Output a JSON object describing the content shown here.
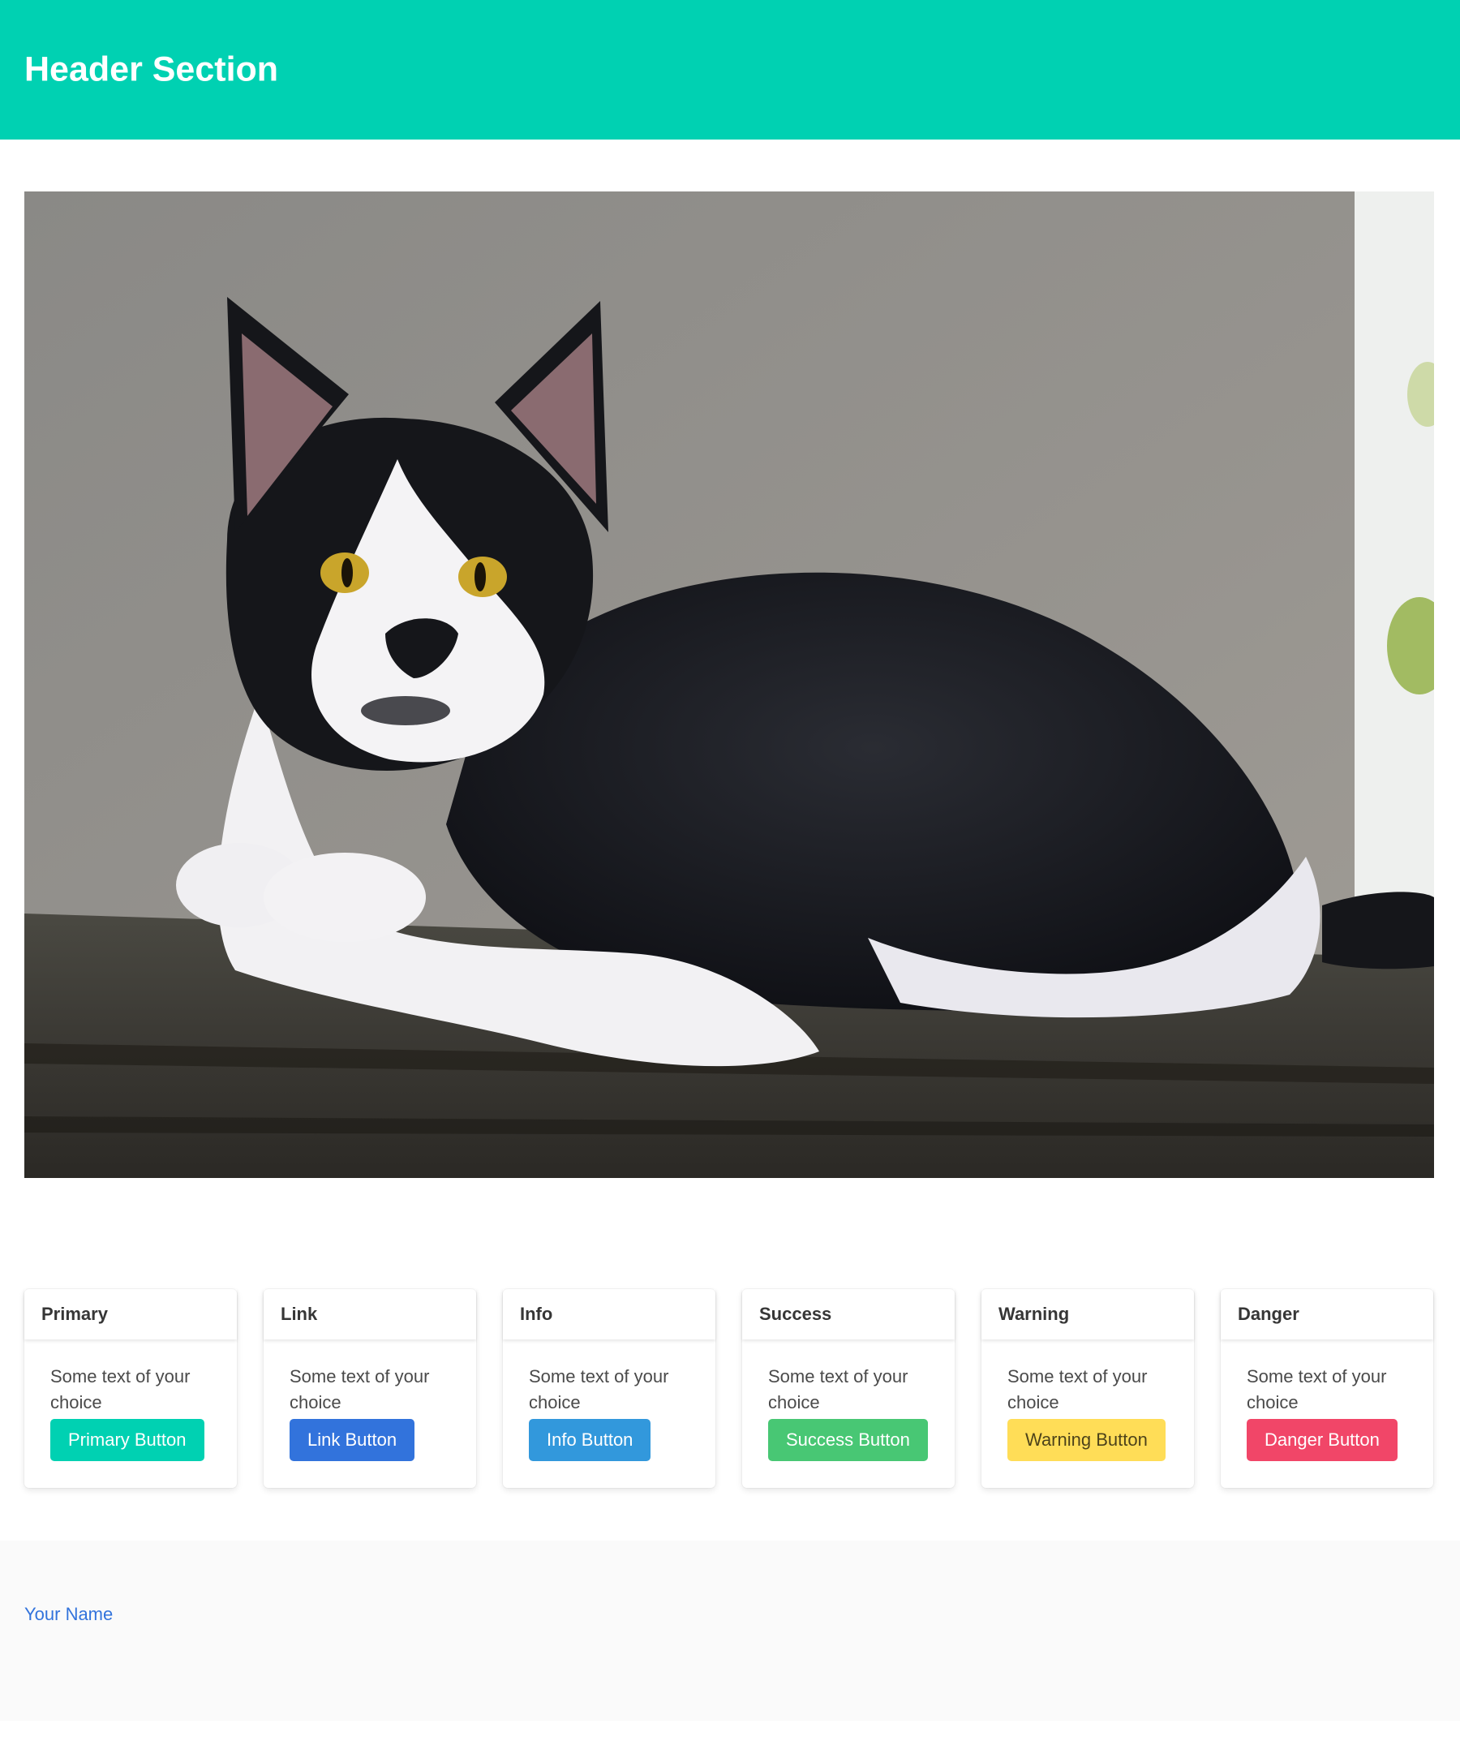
{
  "header": {
    "title": "Header Section"
  },
  "hero": {
    "image_alt": "black and white cat lying on a wooden beam"
  },
  "colors": {
    "primary": "#00d1b2",
    "link": "#3273dc",
    "info": "#3298dc",
    "success": "#48c774",
    "warning": "#ffdd57",
    "danger": "#f14668",
    "footer_bg": "#fafafa"
  },
  "cards": [
    {
      "title": "Primary",
      "text": "Some text of your choice",
      "button": "Primary Button",
      "variant": "primary"
    },
    {
      "title": "Link",
      "text": "Some text of your choice",
      "button": "Link Button",
      "variant": "link"
    },
    {
      "title": "Info",
      "text": "Some text of your choice",
      "button": "Info Button",
      "variant": "info"
    },
    {
      "title": "Success",
      "text": "Some text of your choice",
      "button": "Success Button",
      "variant": "success"
    },
    {
      "title": "Warning",
      "text": "Some text of your choice",
      "button": "Warning Button",
      "variant": "warning"
    },
    {
      "title": "Danger",
      "text": "Some text of your choice",
      "button": "Danger Button",
      "variant": "danger"
    }
  ],
  "footer": {
    "link_text": "Your Name"
  }
}
